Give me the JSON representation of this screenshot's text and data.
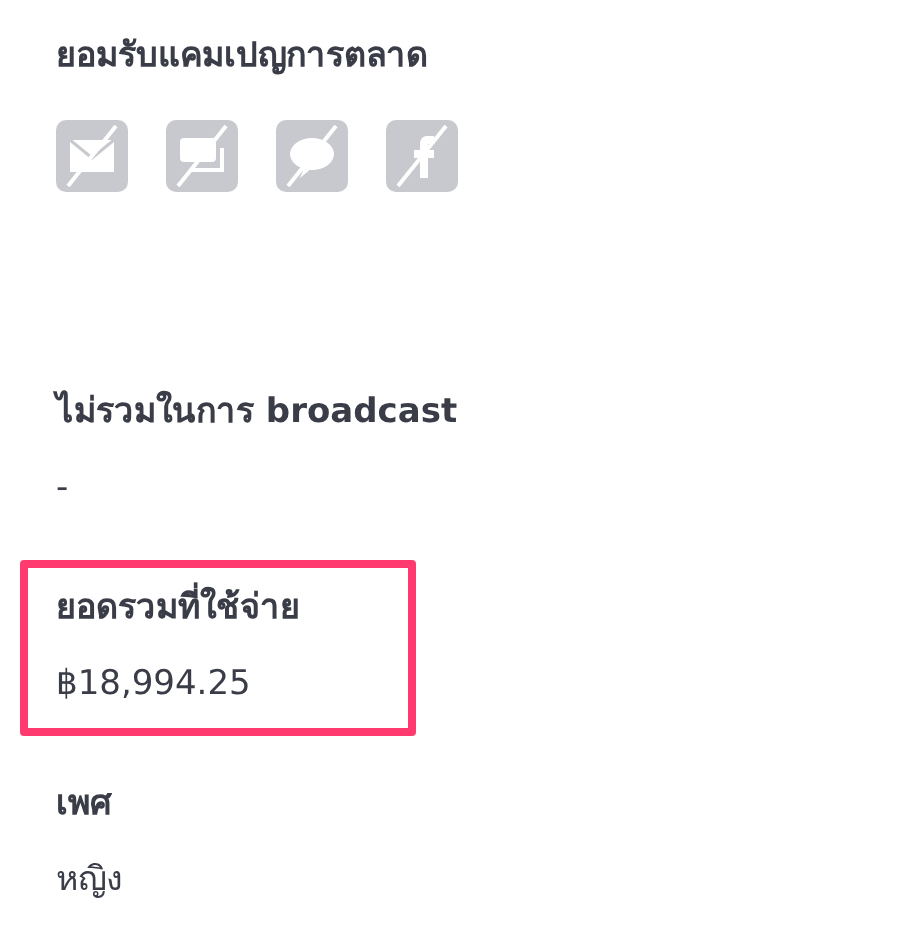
{
  "marketing_consent": {
    "label": "ยอมรับแคมเปญการตลาด",
    "channels": [
      {
        "kind": "email",
        "enabled": false
      },
      {
        "kind": "sms",
        "enabled": false
      },
      {
        "kind": "line",
        "enabled": false
      },
      {
        "kind": "facebook",
        "enabled": false
      }
    ]
  },
  "fields": [
    {
      "label": "ไม่รวมในการ broadcast",
      "value": "-",
      "highlighted": false
    },
    {
      "label": "ยอดรวมที่ใช้จ่าย",
      "value": "฿18,994.25",
      "highlighted": true
    },
    {
      "label": "เพศ",
      "value": "หญิง",
      "highlighted": false
    }
  ]
}
